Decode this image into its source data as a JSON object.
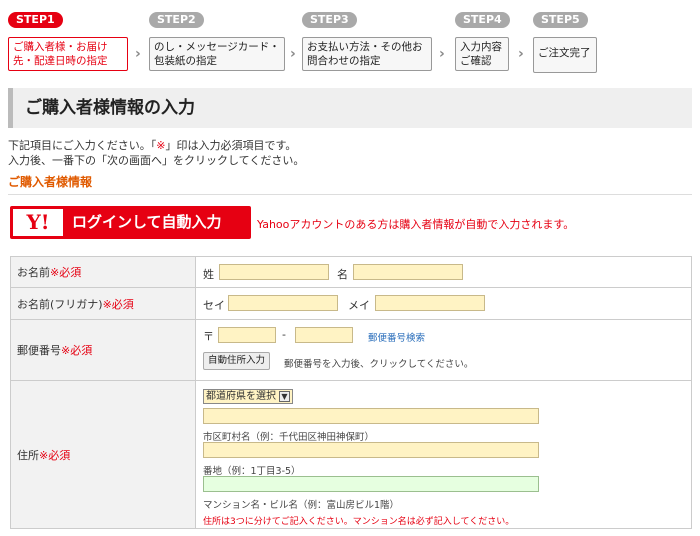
{
  "steps": [
    {
      "tag": "STEP1",
      "label": "ご購入者様・お届け先・配達日時の指定"
    },
    {
      "tag": "STEP2",
      "label": "のし・メッセージカード・包装紙の指定"
    },
    {
      "tag": "STEP3",
      "label": "お支払い方法・その他お問合わせの指定"
    },
    {
      "tag": "STEP4",
      "label": "入力内容ご確認"
    },
    {
      "tag": "STEP5",
      "label": "ご注文完了"
    }
  ],
  "page_title": "ご購入者様情報の入力",
  "intro": {
    "line1_a": "下記項目にご入力ください。「",
    "line1_mark": "※",
    "line1_b": "」印は入力必須項目です。",
    "line2": "入力後、一番下の「次の画面へ」をクリックしてください。"
  },
  "section_label": "ご購入者様情報",
  "yahoo": {
    "logo": "Y!",
    "button": "ログインして自動入力",
    "note": "Yahooアカウントのある方は購入者情報が自動で入力されます。"
  },
  "form": {
    "required": "※必須",
    "name": {
      "label": "お名前",
      "sei": "姓",
      "mei": "名"
    },
    "kana": {
      "label": "お名前(フリガナ)",
      "sei": "セイ",
      "mei": "メイ"
    },
    "zip": {
      "label": "郵便番号",
      "prefix": "〒",
      "dash": "-",
      "search_link": "郵便番号検索",
      "auto_button": "自動住所入力",
      "auto_note": "郵便番号を入力後、クリックしてください。"
    },
    "address": {
      "label": "住所",
      "pref_select": "都道府県を選択",
      "city_hint": "市区町村名（例：千代田区神田神保町）",
      "street_hint": "番地（例：1丁目3-5）",
      "building_hint": "マンション名・ビル名（例：富山房ビル1階）",
      "note": "住所は3つに分けてご記入ください。マンション名は必ず記入してください。"
    }
  }
}
